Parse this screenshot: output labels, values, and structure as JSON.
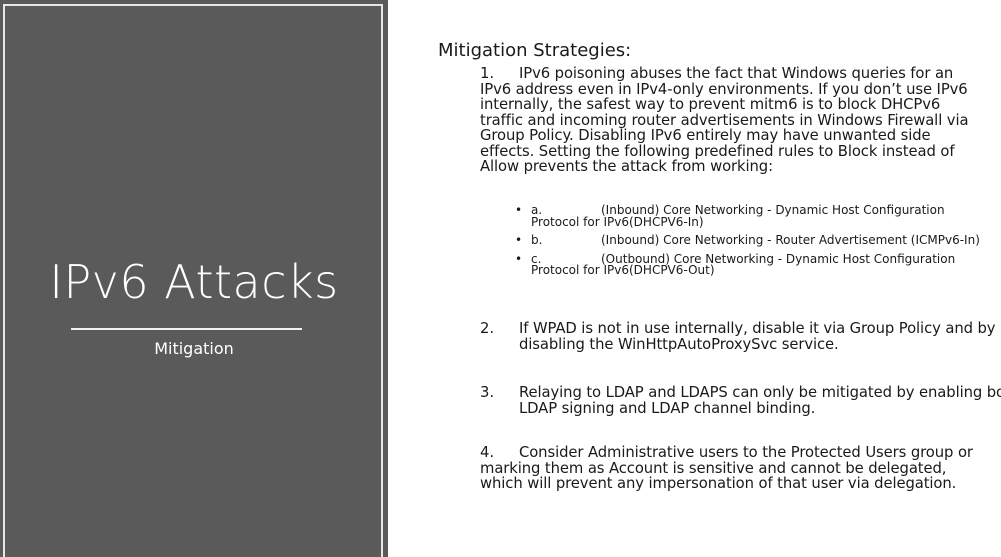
{
  "left": {
    "title": "IPv6 Attacks",
    "subtitle": "Mitigation"
  },
  "main": {
    "heading": "Mitigation Strategies:",
    "steps": [
      {
        "num": "1.",
        "text": "IPv6 poisoning abuses the fact that Windows queries for an IPv6 address even in IPv4-only environments. If you don’t use IPv6 internally, the safest way to prevent mitm6 is to block DHCPv6 traffic and incoming router advertisements in Windows Firewall via Group Policy. Disabling IPv6 entirely may have unwanted side effects. Setting the following predefined rules to Block instead of Allow prevents the attack from working:"
      },
      {
        "num": "2.",
        "text": "If WPAD is not in use internally, disable it via Group Policy and by disabling the WinHttpAutoProxySvc service."
      },
      {
        "num": "3.",
        "text": "Relaying to LDAP and LDAPS can only be mitigated by enabling both LDAP signing and LDAP channel binding."
      },
      {
        "num": "4.",
        "text": "Consider Administrative users to the Protected Users group or marking them as Account is sensitive and cannot be delegated, which will prevent any impersonation of that user via delegation."
      }
    ],
    "bullets": [
      {
        "letter": "a.",
        "text": "(Inbound) Core Networking - Dynamic Host Configuration Protocol for IPv6(DHCPV6-In)"
      },
      {
        "letter": "b.",
        "text": "(Inbound) Core Networking - Router Advertisement (ICMPv6-In)"
      },
      {
        "letter": "c.",
        "text": "(Outbound) Core Networking - Dynamic Host Configuration Protocol for IPv6(DHCPV6-Out)"
      }
    ],
    "bullet_glyph": "•"
  },
  "colors": {
    "panel_bg": "#5a5a5a",
    "panel_text": "#ffffff",
    "body_text": "#1a1a1a"
  }
}
